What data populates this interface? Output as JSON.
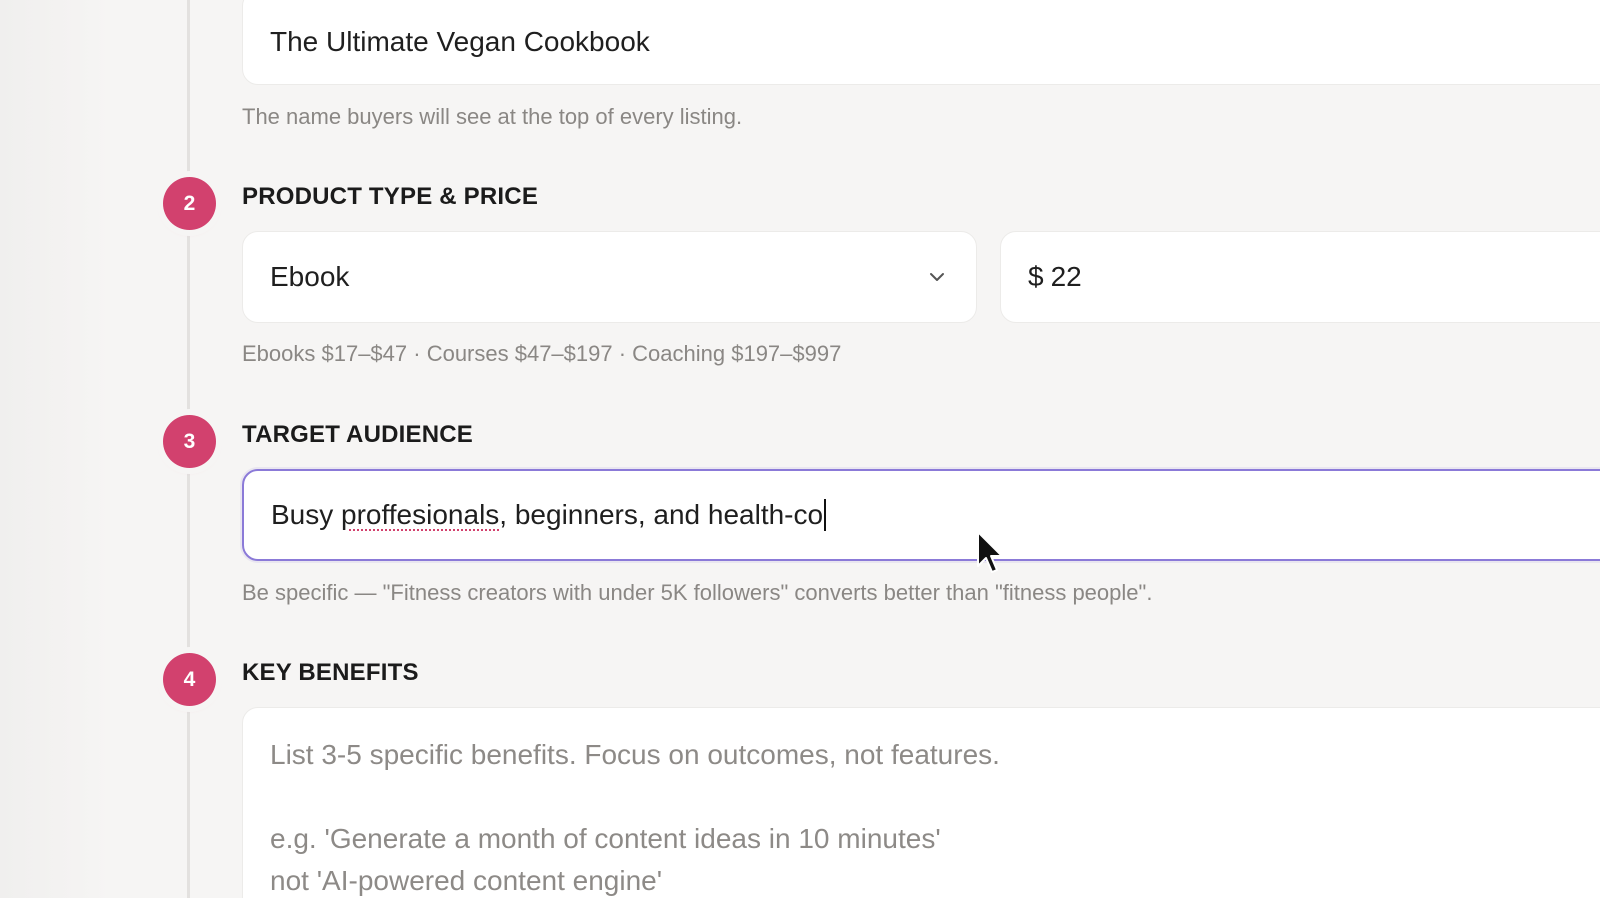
{
  "steps": {
    "step1": {
      "value": "The Ultimate Vegan Cookbook",
      "hint": "The name buyers will see at the top of every listing."
    },
    "step2": {
      "number": "2",
      "label": "PRODUCT TYPE & PRICE",
      "type_value": "Ebook",
      "currency": "$",
      "price_value": "22",
      "hint": "Ebooks $17–$47 · Courses $47–$197 · Coaching $197–$997"
    },
    "step3": {
      "number": "3",
      "label": "TARGET AUDIENCE",
      "value_before": "Busy ",
      "value_misspelled": "proffesionals",
      "value_after": ", beginners, and health-co",
      "hint": "Be specific — \"Fitness creators with under 5K followers\" converts better than \"fitness people\"."
    },
    "step4": {
      "number": "4",
      "label": "KEY BENEFITS",
      "placeholder_line1": "List 3-5 specific benefits. Focus on outcomes, not features.",
      "placeholder_line2": "e.g. 'Generate a month of content ideas in 10 minutes'",
      "placeholder_line3": "not 'AI-powered content engine'"
    }
  },
  "colors": {
    "accent": "#d2416e",
    "focus_border": "#8b7ad8",
    "background": "#f6f5f4"
  },
  "icons": {
    "dropdown": "chevron-down-icon",
    "cursor": "mouse-pointer-icon"
  }
}
